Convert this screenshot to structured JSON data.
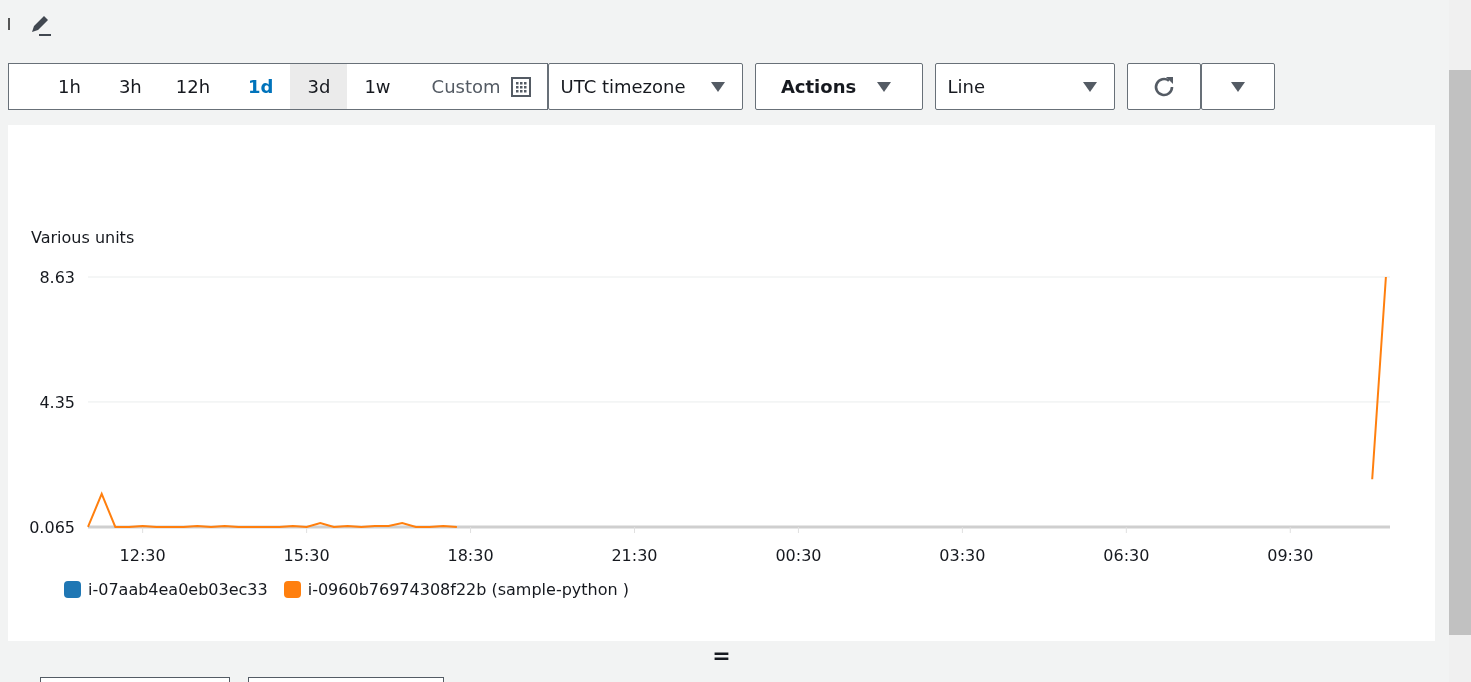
{
  "toolbar": {
    "ranges": [
      {
        "label": "1h",
        "selected": false,
        "hovered": false
      },
      {
        "label": "3h",
        "selected": false,
        "hovered": false
      },
      {
        "label": "12h",
        "selected": false,
        "hovered": false
      },
      {
        "label": "1d",
        "selected": true,
        "hovered": false
      },
      {
        "label": "3d",
        "selected": false,
        "hovered": true
      },
      {
        "label": "1w",
        "selected": false,
        "hovered": false
      }
    ],
    "custom": "Custom",
    "timezone": "UTC timezone",
    "actions": "Actions",
    "chart_type": "Line"
  },
  "graph": {
    "chart_data": {
      "type": "line",
      "ylabel": "Various units",
      "categories": [
        null,
        null,
        null,
        null,
        "12:30",
        null,
        null,
        null,
        null,
        null,
        null,
        null,
        null,
        null,
        null,
        null,
        "15:30",
        null,
        null,
        null,
        null,
        null,
        null,
        null,
        null,
        null,
        null,
        null,
        "18:30",
        null,
        null,
        null,
        null,
        null,
        null,
        null,
        null,
        null,
        null,
        null,
        "21:30",
        null,
        null,
        null,
        null,
        null,
        null,
        null,
        null,
        null,
        null,
        null,
        "00:30",
        null,
        null,
        null,
        null,
        null,
        null,
        null,
        null,
        null,
        null,
        null,
        "03:30",
        null,
        null,
        null,
        null,
        null,
        null,
        null,
        null,
        null,
        null,
        null,
        "06:30",
        null,
        null,
        null,
        null,
        null,
        null,
        null,
        null,
        null,
        null,
        null,
        "09:30",
        null,
        null,
        null,
        null,
        null,
        null,
        null
      ],
      "series": [
        {
          "name": "i-07aab4ea0eb03ec33",
          "color": "#1f77b4",
          "values": [
            null,
            null,
            null,
            null,
            null,
            null,
            null,
            null,
            null,
            null,
            null,
            null,
            null,
            null,
            null,
            null,
            null,
            null,
            null,
            null,
            null,
            null,
            null,
            null,
            null,
            null,
            null,
            null,
            null,
            null,
            null,
            null,
            null,
            null,
            null,
            null,
            null,
            null,
            null,
            null,
            null,
            null,
            null,
            null,
            null,
            null,
            null,
            null,
            null,
            null,
            null,
            null,
            null,
            null,
            null,
            null,
            null,
            null,
            null,
            null,
            null,
            null,
            null,
            null,
            null,
            null,
            null,
            null,
            null,
            null,
            null,
            null,
            null,
            null,
            null,
            null,
            null,
            null,
            null,
            null,
            null,
            null,
            null,
            null,
            null,
            null,
            null,
            null,
            null,
            null,
            null,
            null,
            null,
            null,
            null,
            null
          ]
        },
        {
          "name": "i-0960b76974308f22b (sample-python )",
          "color": "#ff7f0e",
          "values": [
            0.07,
            1.2,
            0.07,
            0.07,
            0.1,
            0.07,
            0.07,
            0.07,
            0.1,
            0.07,
            0.1,
            0.07,
            0.07,
            0.07,
            0.07,
            0.1,
            0.07,
            0.2,
            0.07,
            0.1,
            0.07,
            0.1,
            0.1,
            0.2,
            0.07,
            0.07,
            0.1,
            0.07,
            null,
            null,
            null,
            null,
            null,
            null,
            null,
            null,
            null,
            null,
            null,
            null,
            null,
            null,
            null,
            null,
            null,
            null,
            null,
            null,
            null,
            null,
            null,
            null,
            null,
            null,
            null,
            null,
            null,
            null,
            null,
            null,
            null,
            null,
            null,
            null,
            null,
            null,
            null,
            null,
            null,
            null,
            null,
            null,
            null,
            null,
            null,
            null,
            null,
            null,
            null,
            null,
            null,
            null,
            null,
            null,
            null,
            null,
            null,
            null,
            null,
            null,
            null,
            null,
            null,
            null,
            1.7,
            8.63
          ]
        }
      ],
      "ylim": [
        0.065,
        8.63
      ],
      "yticks": [
        0.065,
        4.35,
        8.63
      ]
    }
  },
  "resize_handle": "="
}
